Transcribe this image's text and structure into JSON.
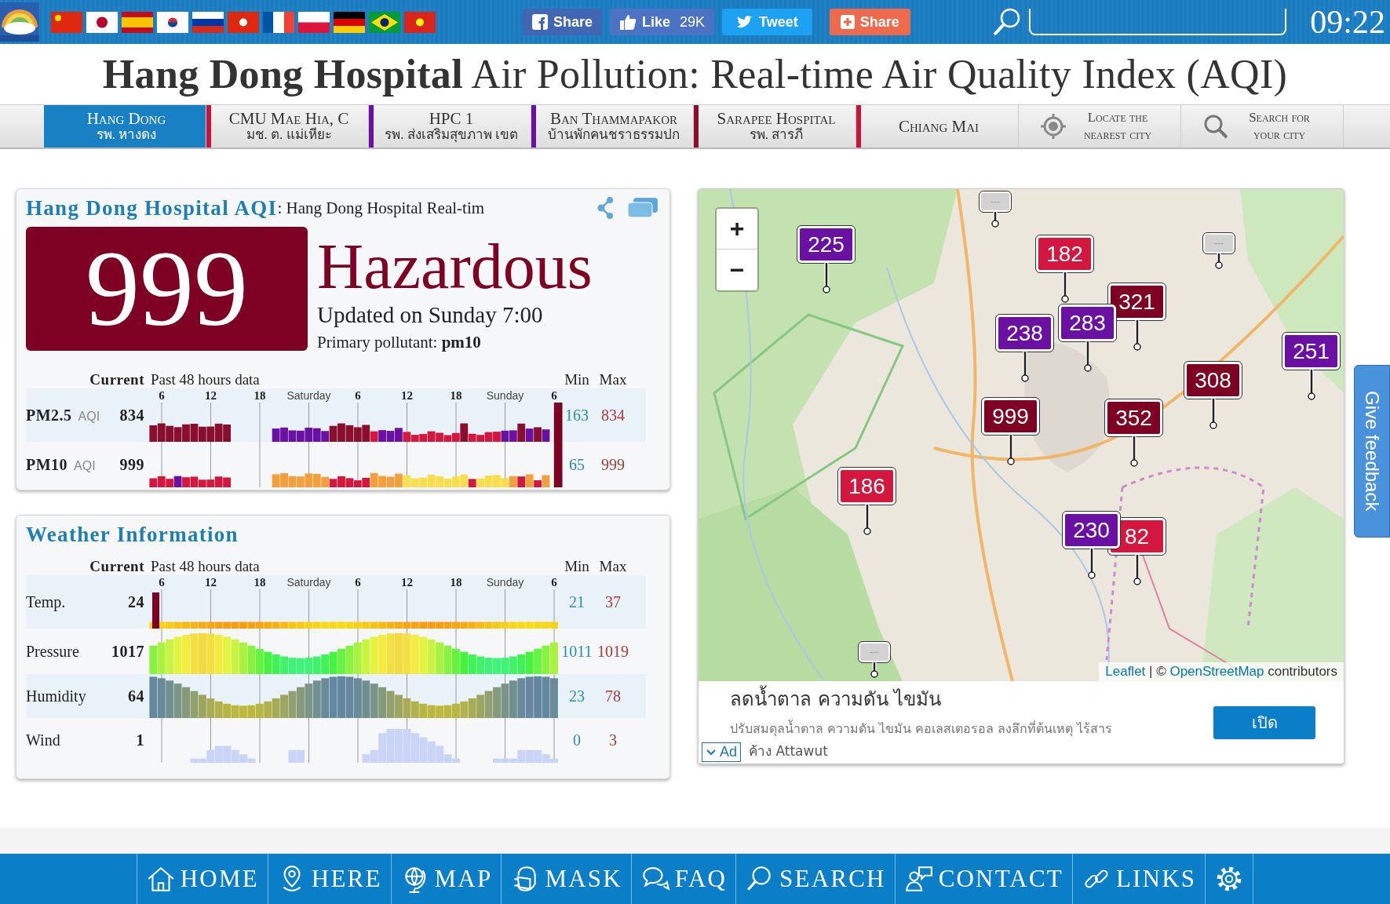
{
  "top_bar": {
    "social_buttons": [
      {
        "kind": "facebook",
        "label": "Share"
      },
      {
        "kind": "like",
        "label": "Like",
        "count": "29K"
      },
      {
        "kind": "twitter",
        "label": "Tweet"
      },
      {
        "kind": "plus",
        "label": "Share"
      }
    ],
    "clock": "09:22"
  },
  "page_title": "**Hang Dong Hospital** Air Pollution: Real-time Air Quality Index (AQI)",
  "nav_tabs": [
    {
      "kind": "station",
      "title": "Hang Dong",
      "subtitle": "รพ. หางดง",
      "selected": true
    },
    {
      "kind": "station",
      "title": "CMU Mae Hia, C",
      "subtitle": "มช. ต. แม่เหียะ",
      "selected": false,
      "color": "#c8143c"
    },
    {
      "kind": "station",
      "title": "HPC 1",
      "subtitle": "รพ. ส่งเสริมสุขภาพ เขต",
      "selected": false,
      "color": "#6a11a3"
    },
    {
      "kind": "station",
      "title": "Ban Thammapakor",
      "subtitle": "บ้านพักคนชราธรรมปก",
      "selected": false,
      "color": "#6a11a3"
    },
    {
      "kind": "station",
      "title": "Sarapee Hospital",
      "subtitle": "รพ. สารภี",
      "selected": false,
      "color": "#8a0f2e"
    },
    {
      "kind": "station",
      "title": "Chiang Mai",
      "selected": false,
      "color": "#c8143c"
    },
    {
      "kind": "locate",
      "title": "Locate the nearest city",
      "selected": false
    },
    {
      "kind": "search",
      "title": "Search for your city",
      "selected": false
    }
  ],
  "aqi_card": {
    "title": "Hang Dong Hospital AQI",
    "subtitle": ": Hang Dong Hospital Real-tim",
    "aqi": "999",
    "level_label": "Hazardous",
    "updated": "Updated on Sunday 7:00",
    "primary_pollutant": "Primary pollutant: **pm10**",
    "history": {
      "current_header": "Current",
      "period_header": "Past 48 hours data",
      "min_header": "Min",
      "max_header": "Max",
      "ticks": [
        {
          "label": "6",
          "kind": "hour"
        },
        {
          "label": "12",
          "kind": "hour"
        },
        {
          "label": "18",
          "kind": "hour"
        },
        {
          "label": "Saturday",
          "kind": "day"
        },
        {
          "label": "6",
          "kind": "hour"
        },
        {
          "label": "12",
          "kind": "hour"
        },
        {
          "label": "18",
          "kind": "hour"
        },
        {
          "label": "Sunday",
          "kind": "day"
        },
        {
          "label": "6",
          "kind": "hour"
        }
      ],
      "rows": [
        {
          "kind": "pm25",
          "name": "PM2.5",
          "unit": "AQI",
          "current": "834",
          "min": "163",
          "max": "834"
        },
        {
          "kind": "pm10",
          "name": "PM10",
          "unit": "AQI",
          "current": "999",
          "min": "65",
          "max": "999"
        }
      ]
    }
  },
  "weather_card": {
    "title": "Weather Information",
    "history": {
      "current_header": "Current",
      "period_header": "Past 48 hours data",
      "min_header": "Min",
      "max_header": "Max",
      "ticks": [
        {
          "label": "6",
          "kind": "hour"
        },
        {
          "label": "12",
          "kind": "hour"
        },
        {
          "label": "18",
          "kind": "hour"
        },
        {
          "label": "Saturday",
          "kind": "day"
        },
        {
          "label": "6",
          "kind": "hour"
        },
        {
          "label": "12",
          "kind": "hour"
        },
        {
          "label": "18",
          "kind": "hour"
        },
        {
          "label": "Sunday",
          "kind": "day"
        },
        {
          "label": "6",
          "kind": "hour"
        }
      ],
      "rows": [
        {
          "kind": "temperature",
          "name": "Temp.",
          "current": "24",
          "min": "21",
          "max": "37"
        },
        {
          "kind": "pressure",
          "name": "Pressure",
          "current": "1017",
          "min": "1011",
          "max": "1019"
        },
        {
          "kind": "humidity",
          "name": "Humidity",
          "current": "64",
          "min": "23",
          "max": "78"
        },
        {
          "kind": "wind",
          "name": "Wind",
          "current": "1",
          "min": "0",
          "max": "3"
        }
      ]
    }
  },
  "map": {
    "zoom_in": "+",
    "zoom_out": "−",
    "markers": [
      {
        "kind": "no_data",
        "label": "---",
        "color": "#d2d2d2"
      },
      {
        "kind": "no_data",
        "label": "---",
        "color": "#d2d2d2"
      },
      {
        "kind": "no_data",
        "label": "---",
        "color": "#d2d2d2"
      },
      {
        "kind": "value",
        "label": "182",
        "color": "#d4173f"
      },
      {
        "kind": "value",
        "label": "225",
        "color": "#6a11a3"
      },
      {
        "kind": "value",
        "label": "238",
        "color": "#6a11a3"
      },
      {
        "kind": "value",
        "label": "321",
        "color": "#7e0023"
      },
      {
        "kind": "value",
        "label": "283",
        "color": "#6a11a3"
      },
      {
        "kind": "value",
        "label": "251",
        "color": "#6a11a3"
      },
      {
        "kind": "value",
        "label": "308",
        "color": "#7e0023"
      },
      {
        "kind": "value",
        "label": "999",
        "color": "#7e0023"
      },
      {
        "kind": "value",
        "label": "352",
        "color": "#7e0023"
      },
      {
        "kind": "value",
        "label": "186",
        "color": "#d4173f"
      },
      {
        "kind": "value",
        "label": "82",
        "color": "#d4173f"
      },
      {
        "kind": "value",
        "label": "230",
        "color": "#6a11a3"
      }
    ],
    "attribution": {
      "leaflet": "Leaflet",
      "middle": " | © ",
      "osm": "OpenStreetMap",
      "rest": " contributors"
    }
  },
  "ad": {
    "title": "ลดน้ำตาล ความดัน ไขมัน",
    "description": "ปรับสมดุลน้ำตาล ความดัน ไขมัน คอเลสเตอรอล ลงลึกที่ต้นเหตุ ไร้สาร",
    "advertiser": "ค้าง Attawut",
    "button": "เปิด",
    "badge": "Ad"
  },
  "feedback": "Give feedback",
  "bottom_nav": [
    {
      "label": "HOME"
    },
    {
      "label": "HERE"
    },
    {
      "label": "MAP"
    },
    {
      "label": "MASK"
    },
    {
      "label": "FAQ"
    },
    {
      "label": "SEARCH"
    },
    {
      "label": "CONTACT"
    },
    {
      "label": "LINKS"
    }
  ]
}
